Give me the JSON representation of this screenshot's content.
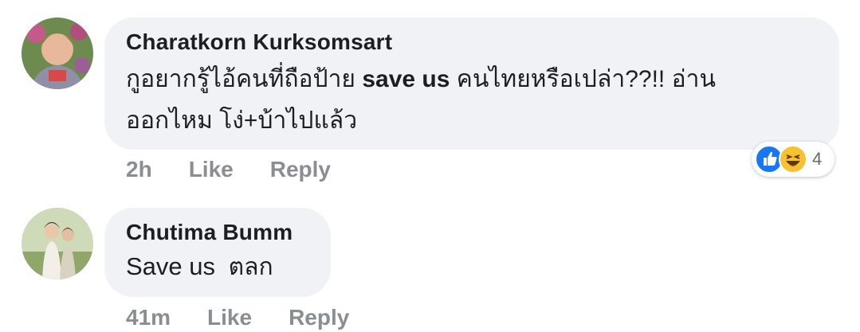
{
  "comments": [
    {
      "author": "Charatkorn Kurksomsart",
      "text_line1_a": "กูอยากรู้ไอ้คนที่ถือป้าย ",
      "text_line1_b": "save us",
      "text_line1_c": " คนไทยหรือเปล่า??!! อ่าน",
      "text_line2": "ออกไหม โง่+บ้าไปแล้ว",
      "time": "2h",
      "like_label": "Like",
      "reply_label": "Reply",
      "reaction_count": "4",
      "reactions": [
        "like-icon",
        "haha-icon"
      ]
    },
    {
      "author": "Chutima Bumm",
      "text_a": "Save us",
      "text_b": "  ตลก",
      "time": "41m",
      "like_label": "Like",
      "reply_label": "Reply"
    }
  ],
  "colors": {
    "bubble": "#f0f2f5",
    "author": "#1c1e21",
    "meta": "#8a8d91",
    "like_blue": "#1877f2",
    "haha_yellow": "#f7c12f"
  }
}
